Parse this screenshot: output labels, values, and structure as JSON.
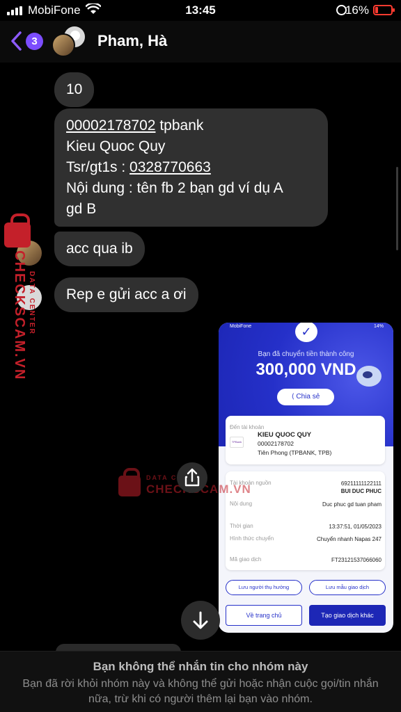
{
  "status_bar": {
    "carrier": "MobiFone",
    "time": "13:45",
    "battery": "16%"
  },
  "header": {
    "unread_count": "3",
    "title": "Pham, Hà"
  },
  "messages": [
    {
      "text": "10"
    },
    {
      "lines": [
        {
          "account": "00002178702",
          "bank": " tpbank"
        },
        {
          "text": "Kieu Quoc Quy"
        },
        {
          "prefix": "Tsr/gt1s : ",
          "phone": "0328770663"
        },
        {
          "text": "Nội dung : tên fb 2 bạn gd ví dụ A"
        },
        {
          "text": "gd B"
        }
      ]
    },
    {
      "text": "acc qua ib"
    },
    {
      "text": "Rep e gửi acc a ơi"
    }
  ],
  "watermark": {
    "brand": "CHECKSCAM.VN",
    "sub": "DATA CENTER",
    "center_top": "DATA CENTER",
    "center_main": "CHECKSCAM.VN"
  },
  "receipt": {
    "status_carrier": "MobiFone",
    "status_battery": "14%",
    "sent_label": "Bạn đã chuyển tiền thành công",
    "amount": "300,000 VND",
    "share_label": "Chia sẻ",
    "to_account_label": "Đến tài khoản",
    "bank_logo": "TPBank",
    "recipient_name": "KIEU QUOC QUY",
    "recipient_account": "00002178702",
    "recipient_bank": "Tiên Phong (TPBANK, TPB)",
    "details": [
      {
        "key": "Tài khoản nguồn",
        "value": "69211111122111",
        "value2": "BUI DUC PHUC"
      },
      {
        "key": "Nội dung",
        "value": "Duc phuc gd tuan pham"
      },
      {
        "key": "Thời gian",
        "value": "13:37:51, 01/05/2023"
      },
      {
        "key": "Hình thức chuyển",
        "value": "Chuyển nhanh Napas 247"
      },
      {
        "key": "Mã giao dịch",
        "value": "FT23121537066060"
      }
    ],
    "save_payee": "Lưu người thụ hưởng",
    "save_template": "Lưu mẫu giao dịch",
    "home_button": "Về trang chủ",
    "new_transaction_button": "Tạo giao dịch khác"
  },
  "footer": {
    "heading": "Bạn không thể nhắn tin cho nhóm này",
    "body": "Bạn đã rời khỏi nhóm này và không thể gửi hoặc nhận cuộc gọi/tin nhắn nữa, trừ khi có người thêm lại bạn vào nhóm."
  },
  "colors": {
    "accent": "#7c4dff",
    "bubble": "#303030",
    "receipt_blue": "#2530c9",
    "watermark": "#c4202a"
  }
}
